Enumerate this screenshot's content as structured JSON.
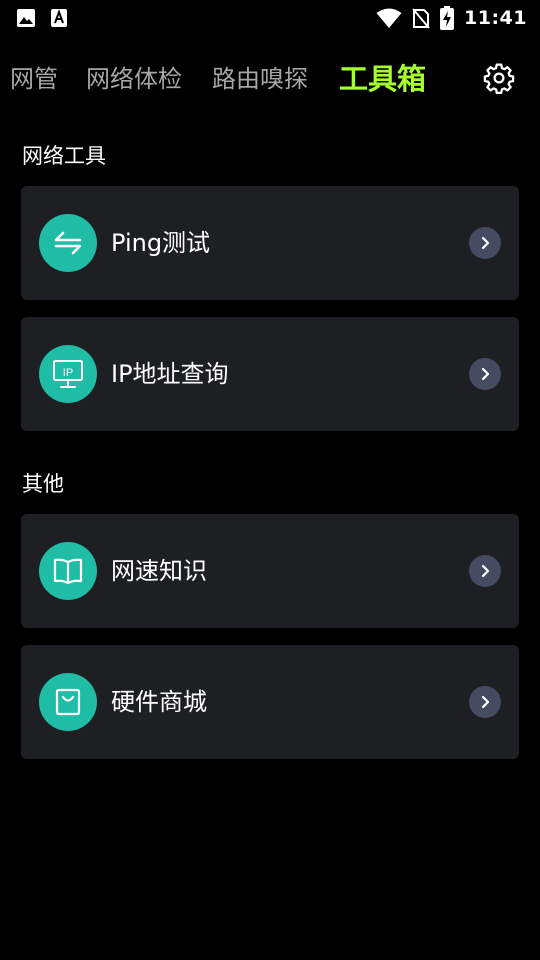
{
  "status_bar": {
    "time": "11:41",
    "icons": [
      "image-icon",
      "font-a-icon",
      "wifi-icon",
      "no-sim-icon",
      "battery-charging-icon"
    ]
  },
  "tabs": [
    {
      "label": "网管",
      "active": false
    },
    {
      "label": "网络体检",
      "active": false
    },
    {
      "label": "路由嗅探",
      "active": false
    },
    {
      "label": "工具箱",
      "active": true
    }
  ],
  "accent_color": "#a6ff2f",
  "icon_circle_color": "#1fbda6",
  "sections": [
    {
      "title": "网络工具",
      "items": [
        {
          "label": "Ping测试",
          "icon": "swap-arrows-icon"
        },
        {
          "label": "IP地址查询",
          "icon": "ip-monitor-icon"
        }
      ]
    },
    {
      "title": "其他",
      "items": [
        {
          "label": "网速知识",
          "icon": "book-icon"
        },
        {
          "label": "硬件商城",
          "icon": "shopping-bag-icon"
        }
      ]
    }
  ]
}
